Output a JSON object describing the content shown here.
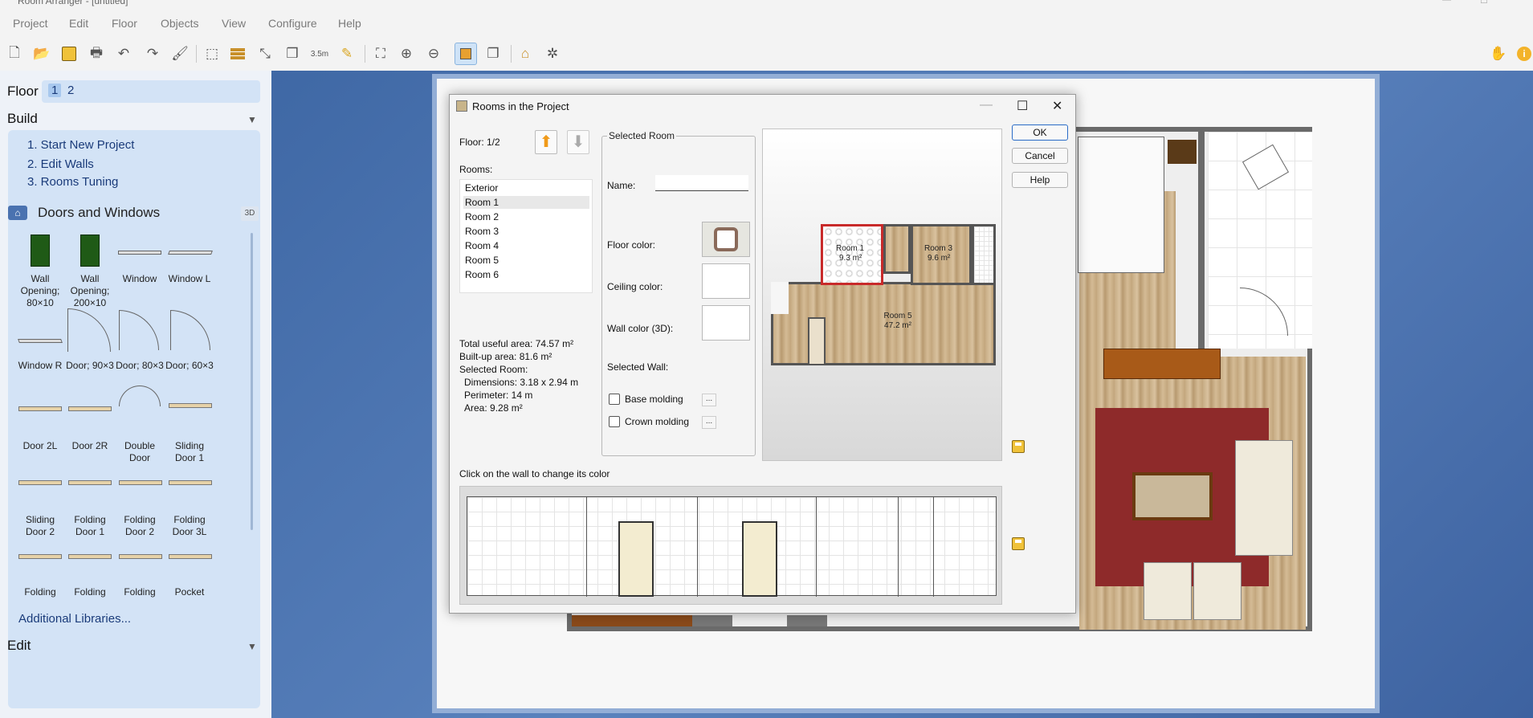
{
  "app": {
    "title": "Room Arranger - [untitled]"
  },
  "menu": [
    "Project",
    "Edit",
    "Floor",
    "Objects",
    "View",
    "Configure",
    "Help"
  ],
  "toolbar": {
    "measure_label": "3.5m"
  },
  "left": {
    "floor_label": "Floor",
    "floors": [
      "1",
      "2"
    ],
    "build_title": "Build",
    "build_links": [
      "1. Start New Project",
      "2. Edit Walls",
      "3. Rooms Tuning"
    ],
    "doors_title": "Doors and Windows",
    "doors_badge": "3D",
    "library": [
      "Wall Opening; 80×10",
      "Wall Opening; 200×10",
      "Window",
      "Window L",
      "Window R",
      "Door; 90×3",
      "Door; 80×3",
      "Door; 60×3",
      "Door 2L",
      "Door 2R",
      "Double Door",
      "Sliding Door 1",
      "Sliding Door 2",
      "Folding Door 1",
      "Folding Door 2",
      "Folding Door 3L",
      "Folding",
      "Folding",
      "Folding",
      "Pocket"
    ],
    "additional_libraries": "Additional Libraries...",
    "edit_title": "Edit"
  },
  "dialog": {
    "title": "Rooms in the Project",
    "floor_text": "Floor: 1/2",
    "rooms_label": "Rooms:",
    "rooms": [
      "Exterior",
      "Room 1",
      "Room 2",
      "Room 3",
      "Room 4",
      "Room 5",
      "Room 6"
    ],
    "selected_index": 1,
    "stats": {
      "total_useful": "Total useful area: 74.57 m²",
      "built_up": "Built-up area: 81.6 m²",
      "selected_room": "Selected Room:",
      "dimensions": "Dimensions: 3.18 x 2.94 m",
      "perimeter": "Perimeter: 14 m",
      "area": "Area: 9.28 m²"
    },
    "selected_room_title": "Selected Room",
    "name_label": "Name:",
    "name_value": "",
    "floor_color_label": "Floor color:",
    "ceiling_color_label": "Ceiling color:",
    "wall_color_label": "Wall color (3D):",
    "selected_wall_label": "Selected Wall:",
    "base_molding": "Base molding",
    "crown_molding": "Crown molding",
    "dots": "...",
    "ok": "OK",
    "cancel": "Cancel",
    "help": "Help",
    "wall_hint": "Click on the wall to change its color",
    "preview_rooms": [
      {
        "name": "Room 1",
        "area": "9.3 m²"
      },
      {
        "name": "Room 3",
        "area": "9.6 m²"
      },
      {
        "name": "Room 5",
        "area": "47.2 m²"
      }
    ]
  },
  "colors": {
    "accent": "#2a6cc7",
    "panel": "#d3e3f6",
    "workspace": "#4a72b0",
    "rug": "#8e2a2a",
    "wood": "#c8ad85"
  }
}
